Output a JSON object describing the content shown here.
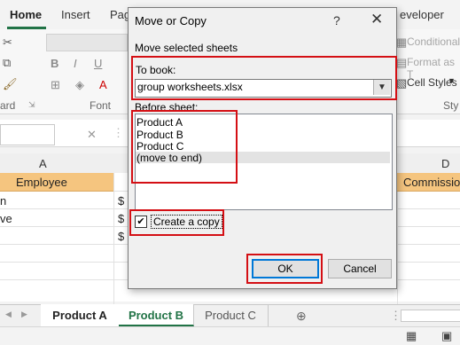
{
  "ribbon": {
    "tabs": [
      "Home",
      "Insert",
      "Pag",
      "eveloper"
    ],
    "groups": {
      "clipboard": "ard",
      "font": "Font",
      "styles": "Sty"
    },
    "styles_items": [
      "Conditional",
      "Format as T",
      "Cell Styles"
    ],
    "font_buttons": [
      "B",
      "I",
      "U"
    ]
  },
  "grid": {
    "col_a": "A",
    "col_d": "D",
    "employee_header": "Employee",
    "commission_header": "Commissio",
    "row1_a": "n",
    "row2_a": "ve",
    "dollar": "$"
  },
  "sheet_tabs": [
    "Product A",
    "Product B",
    "Product C"
  ],
  "dialog": {
    "title": "Move or Copy",
    "help": "?",
    "close": "✕",
    "instruction": "Move selected sheets",
    "to_book_label": "To book:",
    "to_book_value": "group worksheets.xlsx",
    "before_sheet_label": "Before sheet:",
    "sheets": [
      "Product A",
      "Product B",
      "Product C",
      "(move to end)"
    ],
    "create_copy_label": "Create a copy",
    "ok": "OK",
    "cancel": "Cancel"
  },
  "colors": {
    "accent": "#217346",
    "highlight": "#d40f14",
    "header_fill": "#f5c57f"
  }
}
